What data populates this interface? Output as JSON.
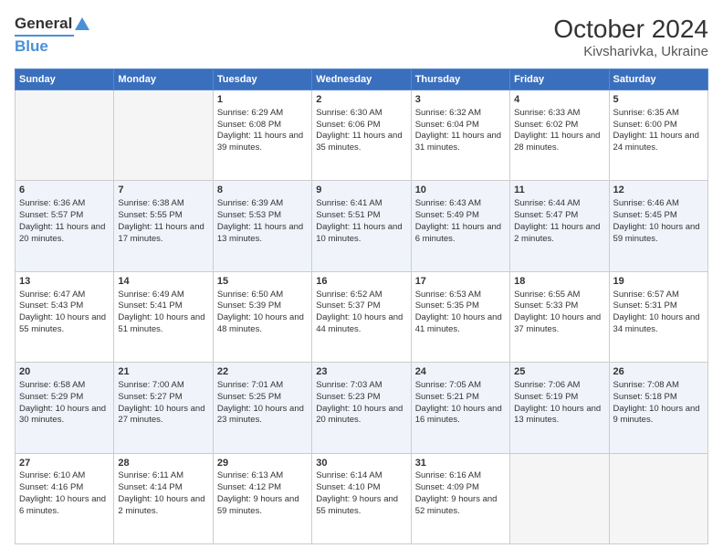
{
  "logo": {
    "line1": "General",
    "line2": "Blue"
  },
  "title": "October 2024",
  "subtitle": "Kivsharivka, Ukraine",
  "days_of_week": [
    "Sunday",
    "Monday",
    "Tuesday",
    "Wednesday",
    "Thursday",
    "Friday",
    "Saturday"
  ],
  "weeks": [
    [
      {
        "day": "",
        "sunrise": "",
        "sunset": "",
        "daylight": "",
        "empty": true
      },
      {
        "day": "",
        "sunrise": "",
        "sunset": "",
        "daylight": "",
        "empty": true
      },
      {
        "day": "1",
        "sunrise": "Sunrise: 6:29 AM",
        "sunset": "Sunset: 6:08 PM",
        "daylight": "Daylight: 11 hours and 39 minutes."
      },
      {
        "day": "2",
        "sunrise": "Sunrise: 6:30 AM",
        "sunset": "Sunset: 6:06 PM",
        "daylight": "Daylight: 11 hours and 35 minutes."
      },
      {
        "day": "3",
        "sunrise": "Sunrise: 6:32 AM",
        "sunset": "Sunset: 6:04 PM",
        "daylight": "Daylight: 11 hours and 31 minutes."
      },
      {
        "day": "4",
        "sunrise": "Sunrise: 6:33 AM",
        "sunset": "Sunset: 6:02 PM",
        "daylight": "Daylight: 11 hours and 28 minutes."
      },
      {
        "day": "5",
        "sunrise": "Sunrise: 6:35 AM",
        "sunset": "Sunset: 6:00 PM",
        "daylight": "Daylight: 11 hours and 24 minutes."
      }
    ],
    [
      {
        "day": "6",
        "sunrise": "Sunrise: 6:36 AM",
        "sunset": "Sunset: 5:57 PM",
        "daylight": "Daylight: 11 hours and 20 minutes."
      },
      {
        "day": "7",
        "sunrise": "Sunrise: 6:38 AM",
        "sunset": "Sunset: 5:55 PM",
        "daylight": "Daylight: 11 hours and 17 minutes."
      },
      {
        "day": "8",
        "sunrise": "Sunrise: 6:39 AM",
        "sunset": "Sunset: 5:53 PM",
        "daylight": "Daylight: 11 hours and 13 minutes."
      },
      {
        "day": "9",
        "sunrise": "Sunrise: 6:41 AM",
        "sunset": "Sunset: 5:51 PM",
        "daylight": "Daylight: 11 hours and 10 minutes."
      },
      {
        "day": "10",
        "sunrise": "Sunrise: 6:43 AM",
        "sunset": "Sunset: 5:49 PM",
        "daylight": "Daylight: 11 hours and 6 minutes."
      },
      {
        "day": "11",
        "sunrise": "Sunrise: 6:44 AM",
        "sunset": "Sunset: 5:47 PM",
        "daylight": "Daylight: 11 hours and 2 minutes."
      },
      {
        "day": "12",
        "sunrise": "Sunrise: 6:46 AM",
        "sunset": "Sunset: 5:45 PM",
        "daylight": "Daylight: 10 hours and 59 minutes."
      }
    ],
    [
      {
        "day": "13",
        "sunrise": "Sunrise: 6:47 AM",
        "sunset": "Sunset: 5:43 PM",
        "daylight": "Daylight: 10 hours and 55 minutes."
      },
      {
        "day": "14",
        "sunrise": "Sunrise: 6:49 AM",
        "sunset": "Sunset: 5:41 PM",
        "daylight": "Daylight: 10 hours and 51 minutes."
      },
      {
        "day": "15",
        "sunrise": "Sunrise: 6:50 AM",
        "sunset": "Sunset: 5:39 PM",
        "daylight": "Daylight: 10 hours and 48 minutes."
      },
      {
        "day": "16",
        "sunrise": "Sunrise: 6:52 AM",
        "sunset": "Sunset: 5:37 PM",
        "daylight": "Daylight: 10 hours and 44 minutes."
      },
      {
        "day": "17",
        "sunrise": "Sunrise: 6:53 AM",
        "sunset": "Sunset: 5:35 PM",
        "daylight": "Daylight: 10 hours and 41 minutes."
      },
      {
        "day": "18",
        "sunrise": "Sunrise: 6:55 AM",
        "sunset": "Sunset: 5:33 PM",
        "daylight": "Daylight: 10 hours and 37 minutes."
      },
      {
        "day": "19",
        "sunrise": "Sunrise: 6:57 AM",
        "sunset": "Sunset: 5:31 PM",
        "daylight": "Daylight: 10 hours and 34 minutes."
      }
    ],
    [
      {
        "day": "20",
        "sunrise": "Sunrise: 6:58 AM",
        "sunset": "Sunset: 5:29 PM",
        "daylight": "Daylight: 10 hours and 30 minutes."
      },
      {
        "day": "21",
        "sunrise": "Sunrise: 7:00 AM",
        "sunset": "Sunset: 5:27 PM",
        "daylight": "Daylight: 10 hours and 27 minutes."
      },
      {
        "day": "22",
        "sunrise": "Sunrise: 7:01 AM",
        "sunset": "Sunset: 5:25 PM",
        "daylight": "Daylight: 10 hours and 23 minutes."
      },
      {
        "day": "23",
        "sunrise": "Sunrise: 7:03 AM",
        "sunset": "Sunset: 5:23 PM",
        "daylight": "Daylight: 10 hours and 20 minutes."
      },
      {
        "day": "24",
        "sunrise": "Sunrise: 7:05 AM",
        "sunset": "Sunset: 5:21 PM",
        "daylight": "Daylight: 10 hours and 16 minutes."
      },
      {
        "day": "25",
        "sunrise": "Sunrise: 7:06 AM",
        "sunset": "Sunset: 5:19 PM",
        "daylight": "Daylight: 10 hours and 13 minutes."
      },
      {
        "day": "26",
        "sunrise": "Sunrise: 7:08 AM",
        "sunset": "Sunset: 5:18 PM",
        "daylight": "Daylight: 10 hours and 9 minutes."
      }
    ],
    [
      {
        "day": "27",
        "sunrise": "Sunrise: 6:10 AM",
        "sunset": "Sunset: 4:16 PM",
        "daylight": "Daylight: 10 hours and 6 minutes."
      },
      {
        "day": "28",
        "sunrise": "Sunrise: 6:11 AM",
        "sunset": "Sunset: 4:14 PM",
        "daylight": "Daylight: 10 hours and 2 minutes."
      },
      {
        "day": "29",
        "sunrise": "Sunrise: 6:13 AM",
        "sunset": "Sunset: 4:12 PM",
        "daylight": "Daylight: 9 hours and 59 minutes."
      },
      {
        "day": "30",
        "sunrise": "Sunrise: 6:14 AM",
        "sunset": "Sunset: 4:10 PM",
        "daylight": "Daylight: 9 hours and 55 minutes."
      },
      {
        "day": "31",
        "sunrise": "Sunrise: 6:16 AM",
        "sunset": "Sunset: 4:09 PM",
        "daylight": "Daylight: 9 hours and 52 minutes."
      },
      {
        "day": "",
        "sunrise": "",
        "sunset": "",
        "daylight": "",
        "empty": true
      },
      {
        "day": "",
        "sunrise": "",
        "sunset": "",
        "daylight": "",
        "empty": true
      }
    ]
  ]
}
